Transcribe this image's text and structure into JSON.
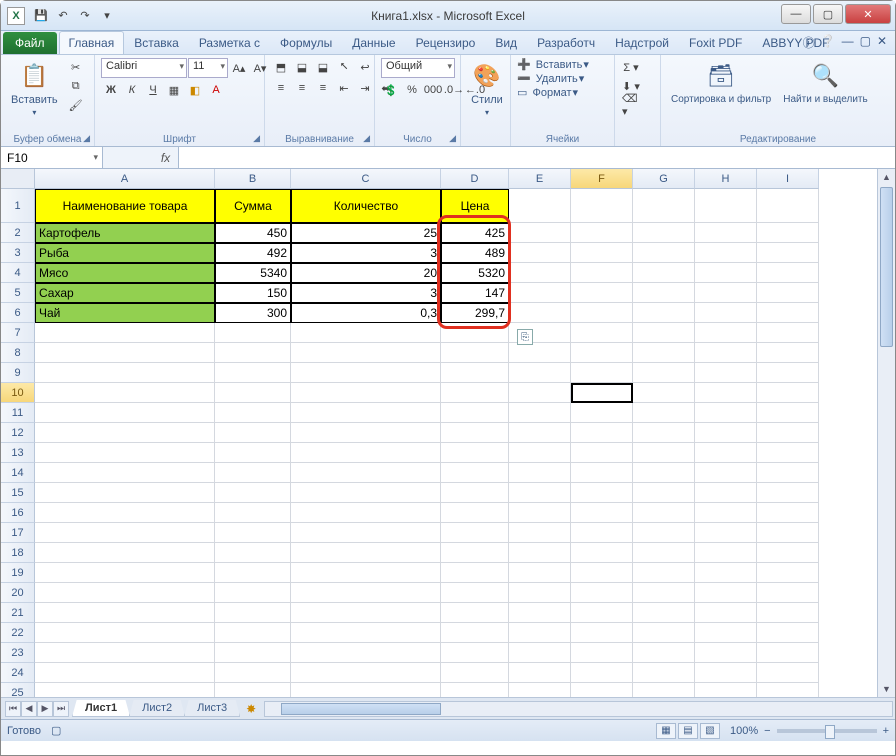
{
  "window": {
    "title": "Книга1.xlsx - Microsoft Excel"
  },
  "qat": {
    "save": "💾",
    "undo": "↶",
    "redo": "↷"
  },
  "tabs": {
    "file": "Файл",
    "items": [
      "Главная",
      "Вставка",
      "Разметка с",
      "Формулы",
      "Данные",
      "Рецензиро",
      "Вид",
      "Разработч",
      "Надстрой",
      "Foxit PDF",
      "ABBYY PDF"
    ],
    "active_index": 0
  },
  "ribbon": {
    "clipboard": {
      "paste": "Вставить",
      "label": "Буфер обмена"
    },
    "font": {
      "name": "Calibri",
      "size": "11",
      "label": "Шрифт"
    },
    "alignment": {
      "label": "Выравнивание"
    },
    "number": {
      "format": "Общий",
      "label": "Число"
    },
    "styles": {
      "btn": "Стили"
    },
    "cells": {
      "insert": "Вставить",
      "delete": "Удалить",
      "format": "Формат",
      "label": "Ячейки"
    },
    "editing": {
      "sort": "Сортировка и фильтр",
      "find": "Найти и выделить",
      "label": "Редактирование"
    }
  },
  "namebox": "F10",
  "formula": "",
  "columns": [
    "A",
    "B",
    "C",
    "D",
    "E",
    "F",
    "G",
    "H",
    "I"
  ],
  "row_count": 27,
  "header_row": {
    "A": "Наименование товара",
    "B": "Сумма",
    "C": "Количество",
    "D": "Цена"
  },
  "data_rows": [
    {
      "A": "Картофель",
      "B": "450",
      "C": "25",
      "D": "425"
    },
    {
      "A": "Рыба",
      "B": "492",
      "C": "3",
      "D": "489"
    },
    {
      "A": "Мясо",
      "B": "5340",
      "C": "20",
      "D": "5320"
    },
    {
      "A": "Сахар",
      "B": "150",
      "C": "3",
      "D": "147"
    },
    {
      "A": "Чай",
      "B": "300",
      "C": "0,3",
      "D": "299,7"
    }
  ],
  "selected_cell": "F10",
  "sheet_tabs": [
    "Лист1",
    "Лист2",
    "Лист3"
  ],
  "active_sheet": 0,
  "status": "Готово",
  "zoom": "100%"
}
